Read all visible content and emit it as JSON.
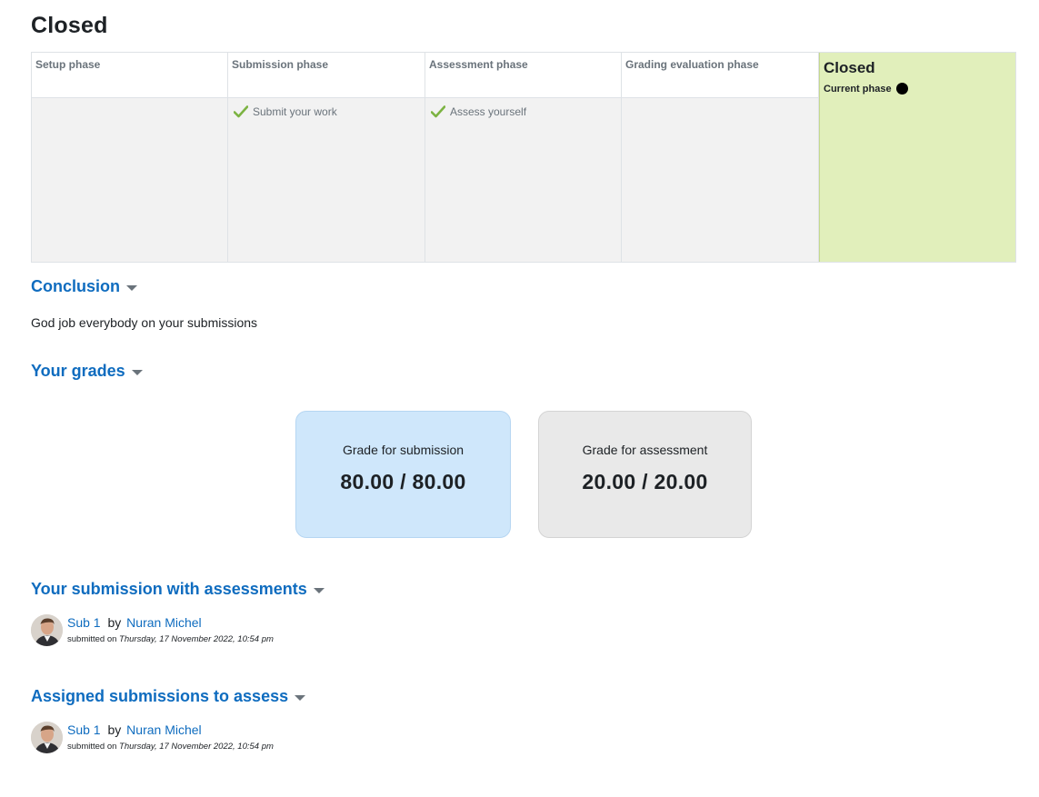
{
  "page": {
    "title": "Closed"
  },
  "phases": [
    {
      "name": "Setup phase",
      "tasks": []
    },
    {
      "name": "Submission phase",
      "tasks": [
        "Submit your work"
      ]
    },
    {
      "name": "Assessment phase",
      "tasks": [
        "Assess yourself"
      ]
    },
    {
      "name": "Grading evaluation phase",
      "tasks": []
    },
    {
      "name": "Closed",
      "current_label": "Current phase",
      "active": true
    }
  ],
  "conclusion": {
    "heading": "Conclusion",
    "text": "God job everybody on your submissions"
  },
  "grades": {
    "heading": "Your grades",
    "submission": {
      "label": "Grade for submission",
      "value": "80.00 / 80.00"
    },
    "assessment": {
      "label": "Grade for assessment",
      "value": "20.00 / 20.00"
    }
  },
  "your_submission": {
    "heading": "Your submission with assessments",
    "entry": {
      "title": "Sub 1",
      "by": "by",
      "author": "Nuran Michel",
      "submitted_prefix": "submitted on",
      "date": "Thursday, 17 November 2022, 10:54 pm"
    }
  },
  "assigned": {
    "heading": "Assigned submissions to assess",
    "entry": {
      "title": "Sub 1",
      "by": "by",
      "author": "Nuran Michel",
      "submitted_prefix": "submitted on",
      "date": "Thursday, 17 November 2022, 10:54 pm"
    }
  },
  "colors": {
    "link": "#0f6cbf",
    "active_phase": "#e1efbb",
    "card_submission": "#cfe7fb",
    "card_assessment": "#e9e9e9",
    "check": "#7cb342"
  }
}
